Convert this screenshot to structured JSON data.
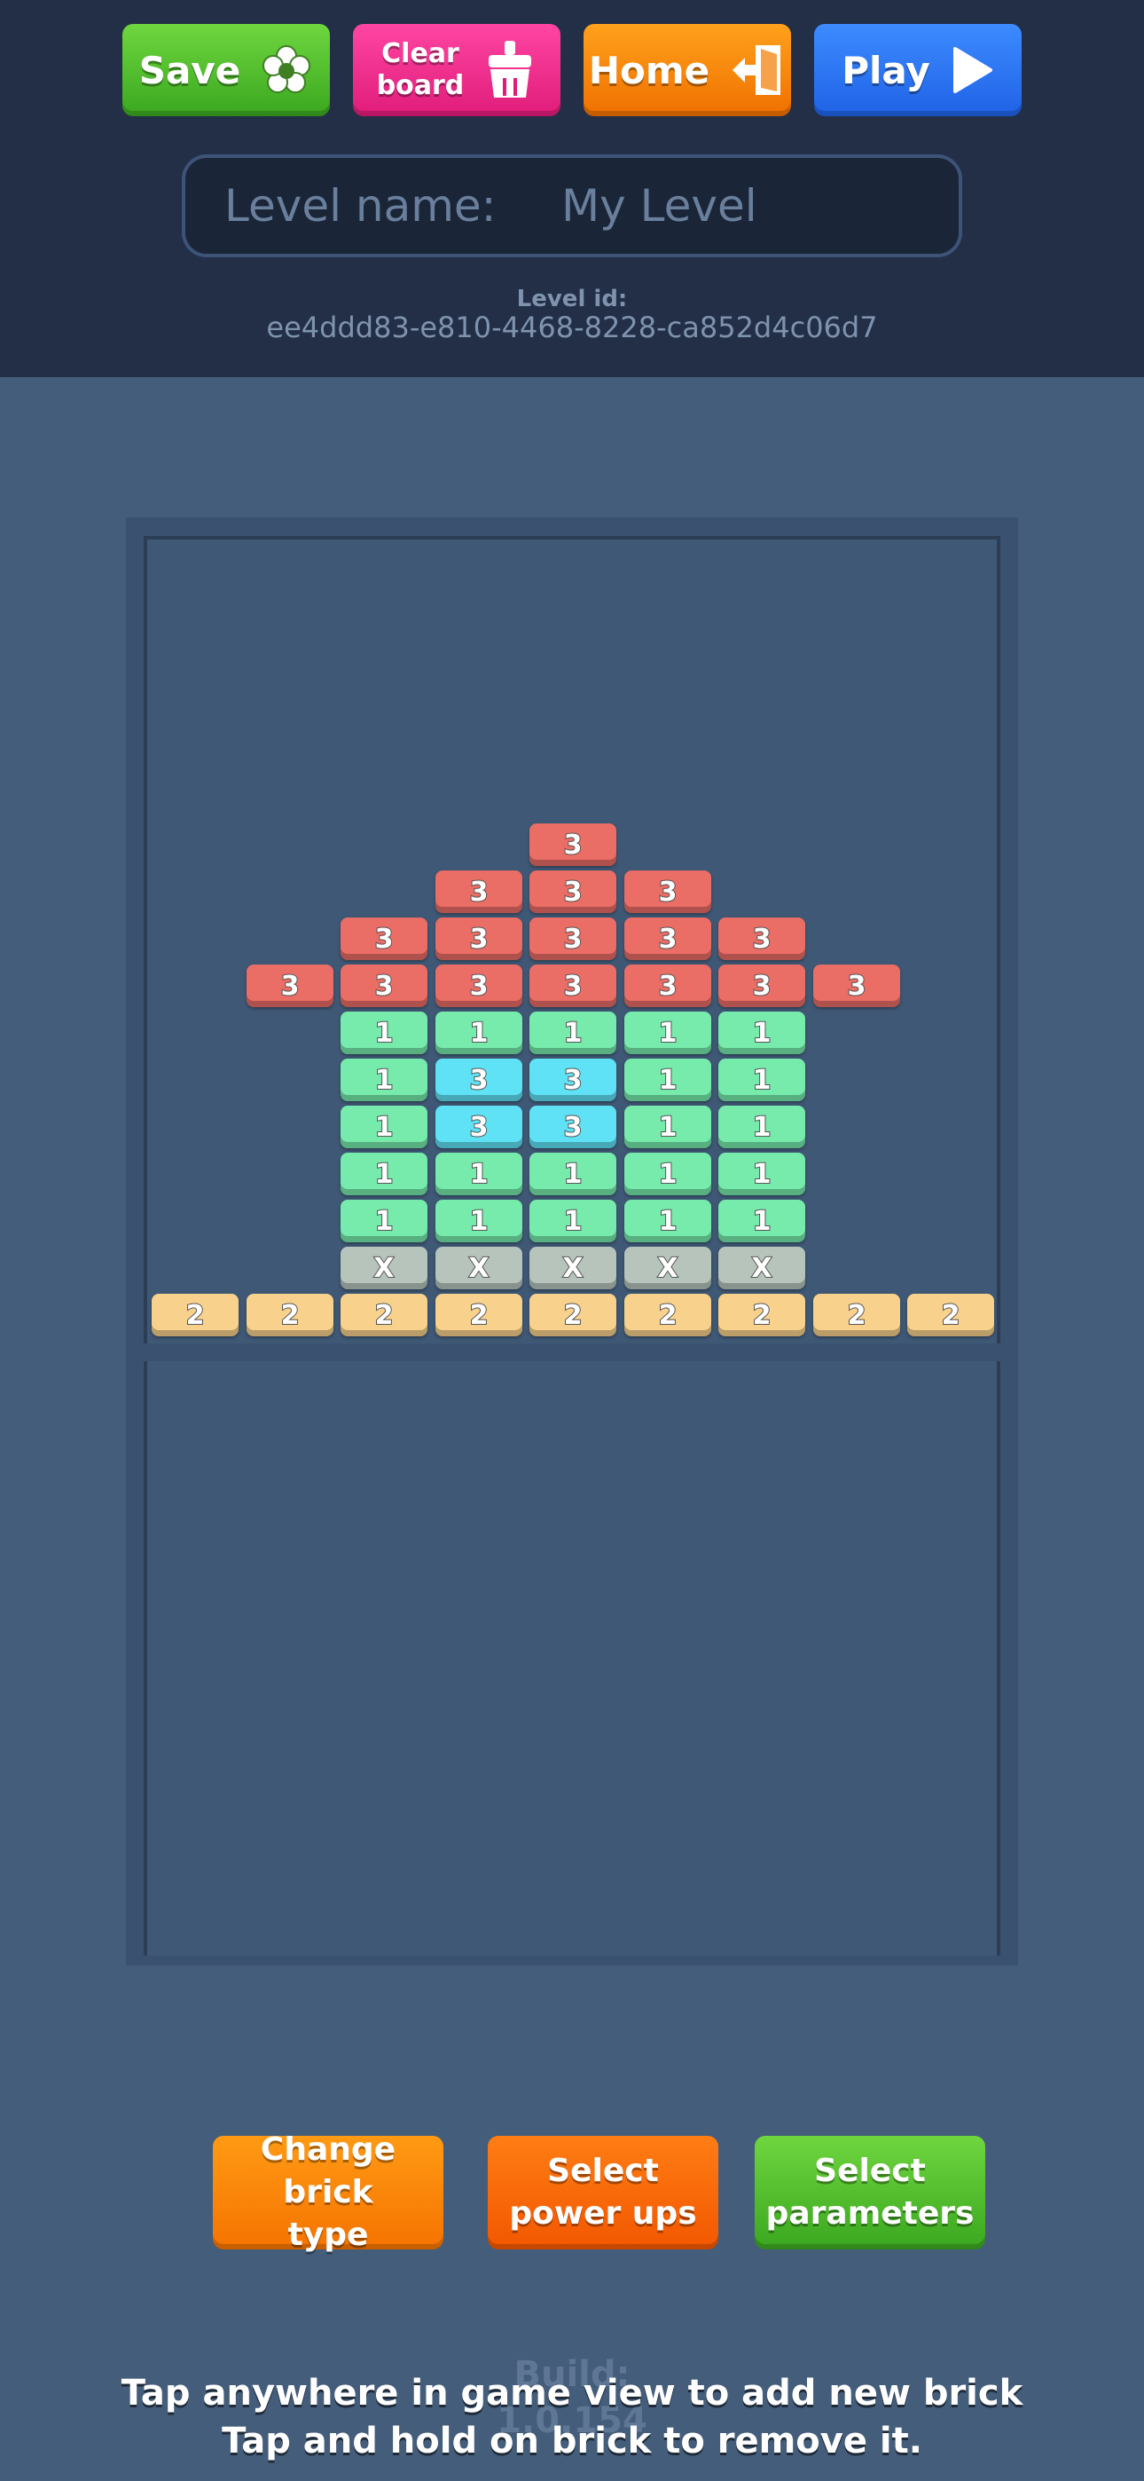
{
  "toolbar": {
    "save_label": "Save",
    "clear_label": "Clear\nboard",
    "home_label": "Home",
    "play_label": "Play"
  },
  "level": {
    "name_label": "Level name:",
    "name_value": "My Level",
    "id_label": "Level id:",
    "id_value": "ee4ddd83-e810-4468-8228-ca852d4c06d7"
  },
  "board": {
    "brick_colors": {
      "red": "#ea6d66",
      "green": "#76ebac",
      "cyan": "#5fe2f6",
      "gray": "#b6c4bc",
      "yellow": "#f8d28c"
    },
    "rows": [
      [
        "",
        "",
        "",
        "",
        "3",
        "",
        "",
        "",
        ""
      ],
      [
        "",
        "",
        "",
        "3",
        "3",
        "3",
        "",
        "",
        ""
      ],
      [
        "",
        "",
        "3",
        "3",
        "3",
        "3",
        "3",
        "",
        ""
      ],
      [
        "",
        "3",
        "3",
        "3",
        "3",
        "3",
        "3",
        "3",
        ""
      ],
      [
        "",
        "",
        "1",
        "1",
        "1",
        "1",
        "1",
        "",
        ""
      ],
      [
        "",
        "",
        "1",
        "3c",
        "3c",
        "1",
        "1",
        "",
        ""
      ],
      [
        "",
        "",
        "1",
        "3c",
        "3c",
        "1",
        "1",
        "",
        ""
      ],
      [
        "",
        "",
        "1",
        "1",
        "1",
        "1",
        "1",
        "",
        ""
      ],
      [
        "",
        "",
        "1",
        "1",
        "1",
        "1",
        "1",
        "",
        ""
      ],
      [
        "",
        "",
        "X",
        "X",
        "X",
        "X",
        "X",
        "",
        ""
      ],
      [
        "2",
        "2",
        "2",
        "2",
        "2",
        "2",
        "2",
        "2",
        "2"
      ]
    ]
  },
  "actions": {
    "change_brick": "Change brick\ntype",
    "power_ups": "Select\npower ups",
    "parameters": "Select\nparameters"
  },
  "build": "Build:\n1.0.154",
  "hint": "Tap anywhere in game view to add new brick\nTap and hold on brick to remove it."
}
